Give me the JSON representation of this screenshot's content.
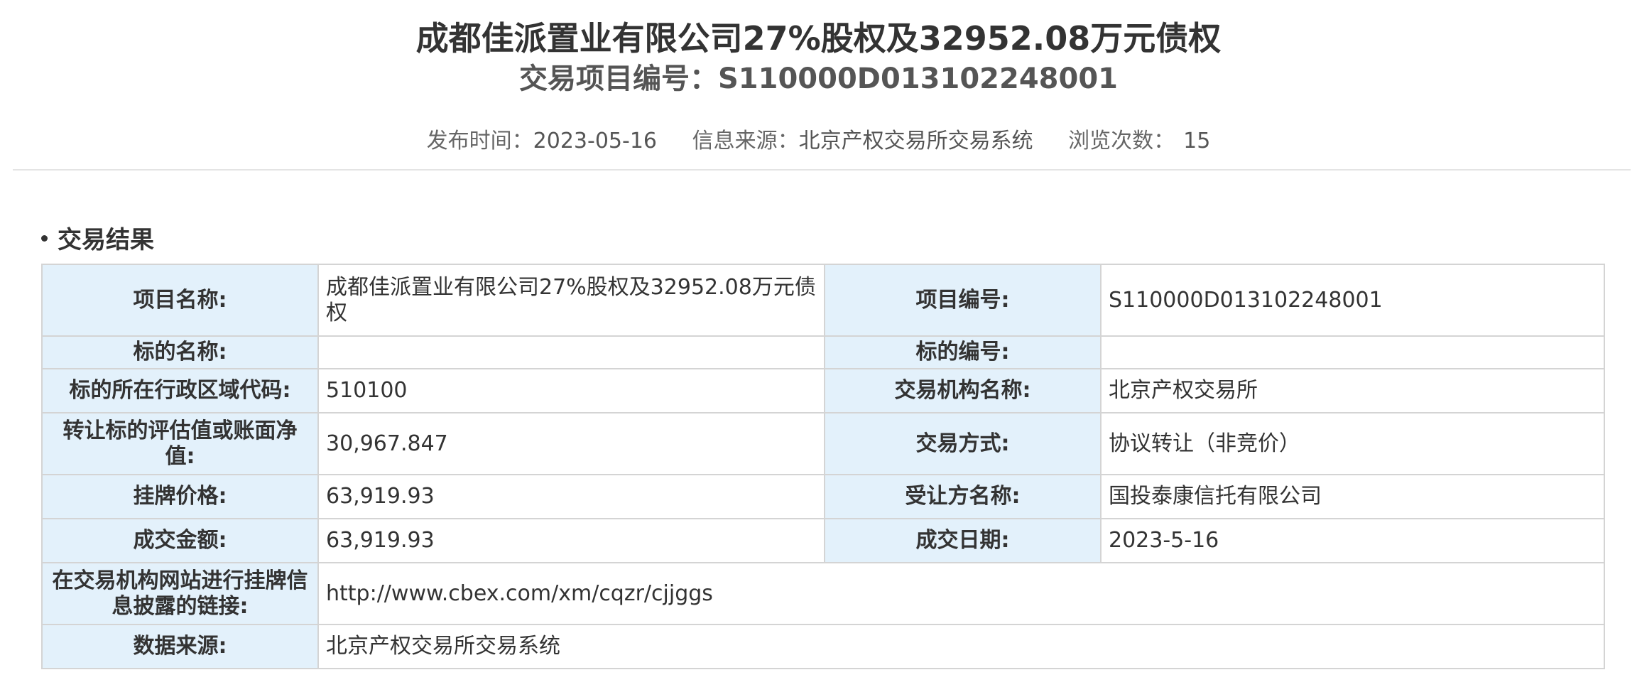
{
  "header": {
    "title": "成都佳派置业有限公司27%股权及32952.08万元债权",
    "subtitle": "交易项目编号：S110000D013102248001",
    "meta": {
      "publish_label": "发布时间：",
      "publish_value": "2023-05-16",
      "source_label": "信息来源：",
      "source_value": "北京产权交易所交易系统",
      "views_label": "浏览次数：",
      "views_value": "15"
    }
  },
  "section": {
    "title": "交易结果"
  },
  "table": {
    "project_name_label": "项目名称:",
    "project_name_value": "成都佳派置业有限公司27%股权及32952.08万元债权",
    "project_no_label": "项目编号:",
    "project_no_value": "S110000D013102248001",
    "subject_name_label": "标的名称:",
    "subject_name_value": "",
    "subject_no_label": "标的编号:",
    "subject_no_value": "",
    "region_code_label": "标的所在行政区域代码:",
    "region_code_value": "510100",
    "institution_label": "交易机构名称:",
    "institution_value": "北京产权交易所",
    "valuation_label": "转让标的评估值或账面净值:",
    "valuation_value": "30,967.847",
    "trade_method_label": "交易方式:",
    "trade_method_value": "协议转让（非竞价）",
    "listing_price_label": "挂牌价格:",
    "listing_price_value": "63,919.93",
    "transferee_label": "受让方名称:",
    "transferee_value": "国投泰康信托有限公司",
    "deal_amount_label": "成交金额:",
    "deal_amount_value": "63,919.93",
    "deal_date_label": "成交日期:",
    "deal_date_value": "2023-5-16",
    "link_label": "在交易机构网站进行挂牌信息披露的链接:",
    "link_value": "http://www.cbex.com/xm/cqzr/cjjggs",
    "data_source_label": "数据来源:",
    "data_source_value": "北京产权交易所交易系统"
  }
}
